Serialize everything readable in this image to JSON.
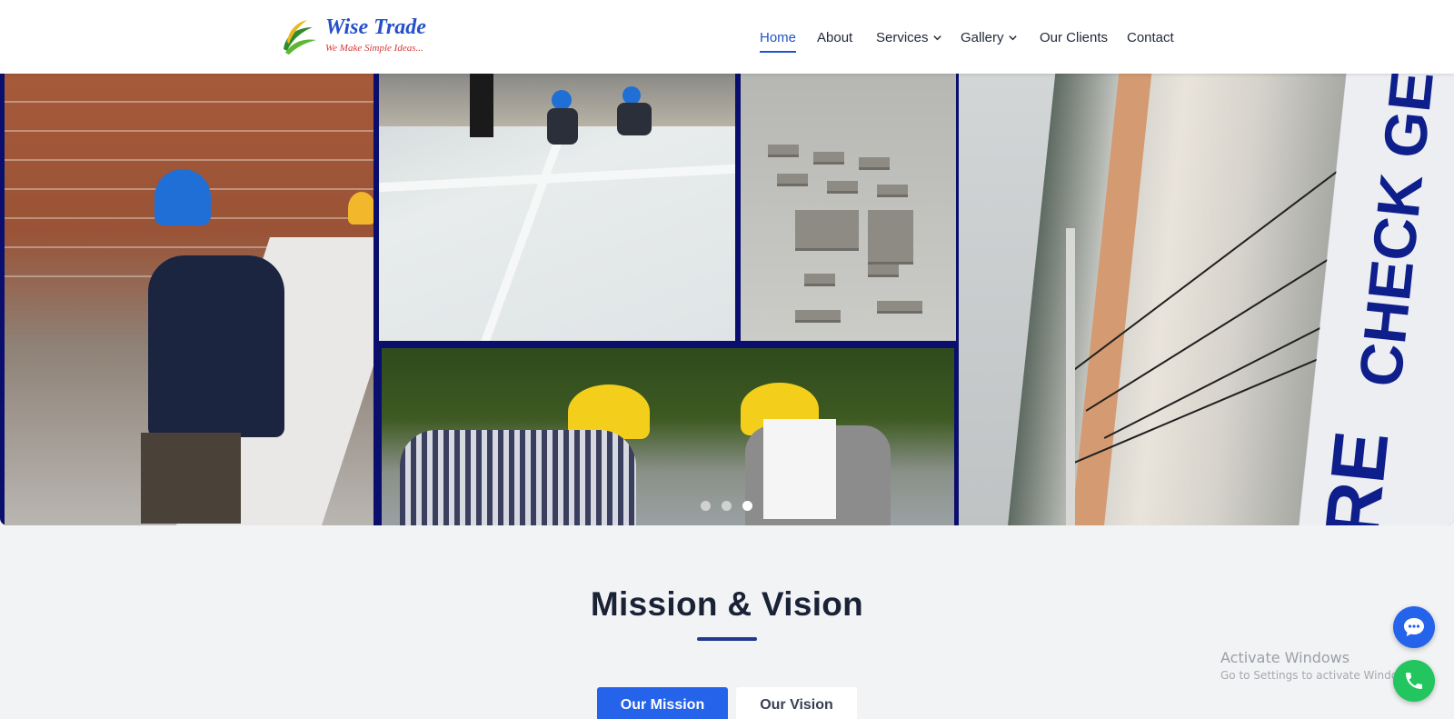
{
  "brand": {
    "name": "Wise Trade",
    "tagline": "We Make Simple Ideas..."
  },
  "nav": {
    "items": [
      {
        "label": "Home",
        "active": true,
        "has_dropdown": false
      },
      {
        "label": "About",
        "active": false,
        "has_dropdown": false
      },
      {
        "label": "Services",
        "active": false,
        "has_dropdown": true
      },
      {
        "label": "Gallery",
        "active": false,
        "has_dropdown": true
      },
      {
        "label": "Our Clients",
        "active": false,
        "has_dropdown": false
      },
      {
        "label": "Contact",
        "active": false,
        "has_dropdown": false
      }
    ]
  },
  "hero": {
    "sign_text_1": "CHECK GE",
    "sign_text_2": "ORE",
    "slides_total": 3,
    "active_slide": 3
  },
  "mission": {
    "title": "Mission & Vision",
    "tabs": [
      {
        "label": "Our Mission",
        "active": true
      },
      {
        "label": "Our Vision",
        "active": false
      }
    ]
  },
  "watermark": {
    "title": "Activate Windows",
    "subtitle": "Go to Settings to activate Windows."
  },
  "floating": {
    "chat_icon": "chat-icon",
    "phone_icon": "phone-icon"
  },
  "colors": {
    "accent": "#2563eb",
    "nav_active": "#2352c9",
    "phone": "#22c55e",
    "brand_blue": "#2550c8",
    "brand_red": "#d23a3a"
  }
}
